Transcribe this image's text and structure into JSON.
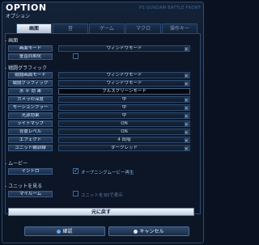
{
  "header": {
    "title": "OPTION",
    "subtitle": "オプション",
    "brand": "PS GUNDAM BATTLE FRONT"
  },
  "tabs": [
    {
      "label": "画面",
      "active": true
    },
    {
      "label": "音",
      "active": false
    },
    {
      "label": "ゲーム",
      "active": false
    },
    {
      "label": "マクロ",
      "active": false
    },
    {
      "label": "操作キー",
      "active": false
    }
  ],
  "sections": {
    "screen": "- 画面",
    "graphics": "- 戦闘グラフィック",
    "movie": "- ムービー",
    "unit": "- ユニットを見る"
  },
  "screen_rows": [
    {
      "label": "画面モード",
      "value": "ウィンドウモード"
    },
    {
      "label": "垂直同期化",
      "checked": false
    }
  ],
  "graphics_rows": [
    {
      "label": "戦闘画面モード",
      "value": "ウィンドウモード"
    },
    {
      "label": "戦闘グラフィック",
      "value": "ウィンドウモード"
    },
    {
      "label": "水 平 効 果",
      "value": "フルスクリーンモード"
    },
    {
      "label": "カメラの深度",
      "value": "中"
    },
    {
      "label": "モーションブラー",
      "value": "中"
    },
    {
      "label": "光源効果",
      "value": "中"
    },
    {
      "label": "ライトマップ",
      "value": "ON"
    },
    {
      "label": "背景レベル",
      "value": "ON"
    },
    {
      "label": "エフェクト",
      "value": "4 段階"
    },
    {
      "label": "ユニット輪郭線",
      "value": "ダークレッド"
    }
  ],
  "movie_row": {
    "label": "イントロ",
    "option": "オープニングムービー再生",
    "checked": true
  },
  "unit_row": {
    "label": "マイルーム",
    "option": "ユニットを3Dで表示",
    "checked": false
  },
  "buttons": {
    "back": "元に戻す",
    "confirm": "確認",
    "cancel": "キャンセル"
  },
  "colors": {
    "accent": "#37b7ff",
    "panel_bg": "#0c1627",
    "border": "#2b4a72"
  }
}
